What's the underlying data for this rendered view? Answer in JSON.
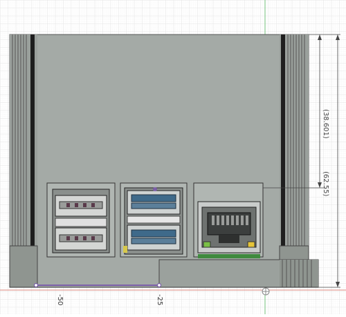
{
  "viewport": {
    "background_color": "#ffffff",
    "grid_color": "#e4e4e4",
    "model_color": "#a6aca8",
    "edge_color": "#3a3a3a",
    "axis_color": "#76c57e",
    "baseline_color": "#e08a80"
  },
  "dimensions": {
    "reference_height": "(38.601)",
    "overall_height": "(62.55)"
  },
  "axis_ticks": {
    "left": "-50",
    "middle": "-25"
  },
  "ports": {
    "usb2_stack": "usb-2-stack",
    "usb3_stack": "usb-3-stack",
    "ethernet": "rj45-ethernet-port"
  },
  "origin_marker": "origin-icon"
}
